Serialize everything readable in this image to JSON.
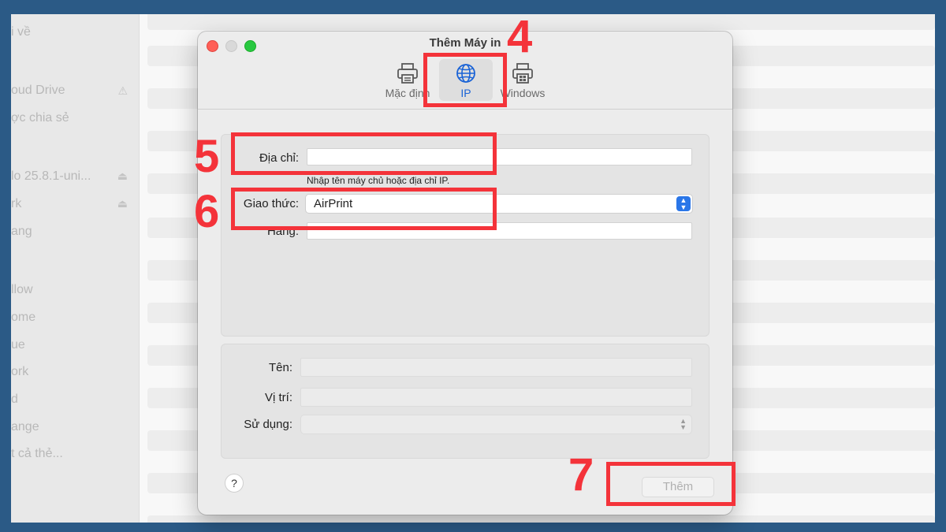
{
  "sidebar": {
    "items": [
      {
        "label": "i về"
      },
      {
        "label": "oud Drive"
      },
      {
        "label": "ợc chia sẻ"
      },
      {
        "label": "lo 25.8.1-uni..."
      },
      {
        "label": "rk"
      },
      {
        "label": "ang"
      },
      {
        "label": "llow"
      },
      {
        "label": "ome"
      },
      {
        "label": "ue"
      },
      {
        "label": "ork"
      },
      {
        "label": "d"
      },
      {
        "label": "ange"
      },
      {
        "label": "t cả thẻ..."
      }
    ]
  },
  "dialog": {
    "title": "Thêm Máy in",
    "tabs": [
      {
        "label": "Mặc định",
        "icon": "printer-icon"
      },
      {
        "label": "IP",
        "icon": "globe-icon"
      },
      {
        "label": "Windows",
        "icon": "windows-printer-icon"
      }
    ],
    "active_tab": "IP",
    "address": {
      "label": "Địa chỉ:",
      "value": "",
      "hint": "Nhập tên máy chủ hoặc địa chỉ IP."
    },
    "protocol": {
      "label": "Giao thức:",
      "value": "AirPrint"
    },
    "queue": {
      "label": "Hàng:",
      "value": ""
    },
    "name": {
      "label": "Tên:",
      "value": ""
    },
    "location": {
      "label": "Vị trí:",
      "value": ""
    },
    "use": {
      "label": "Sử dụng:",
      "value": ""
    },
    "help_label": "?",
    "add_button": "Thêm"
  },
  "annotations": [
    "4",
    "5",
    "6",
    "7"
  ],
  "colors": {
    "annotation": "#f4333a",
    "accent": "#1a63d6",
    "background": "#2b5a86"
  }
}
